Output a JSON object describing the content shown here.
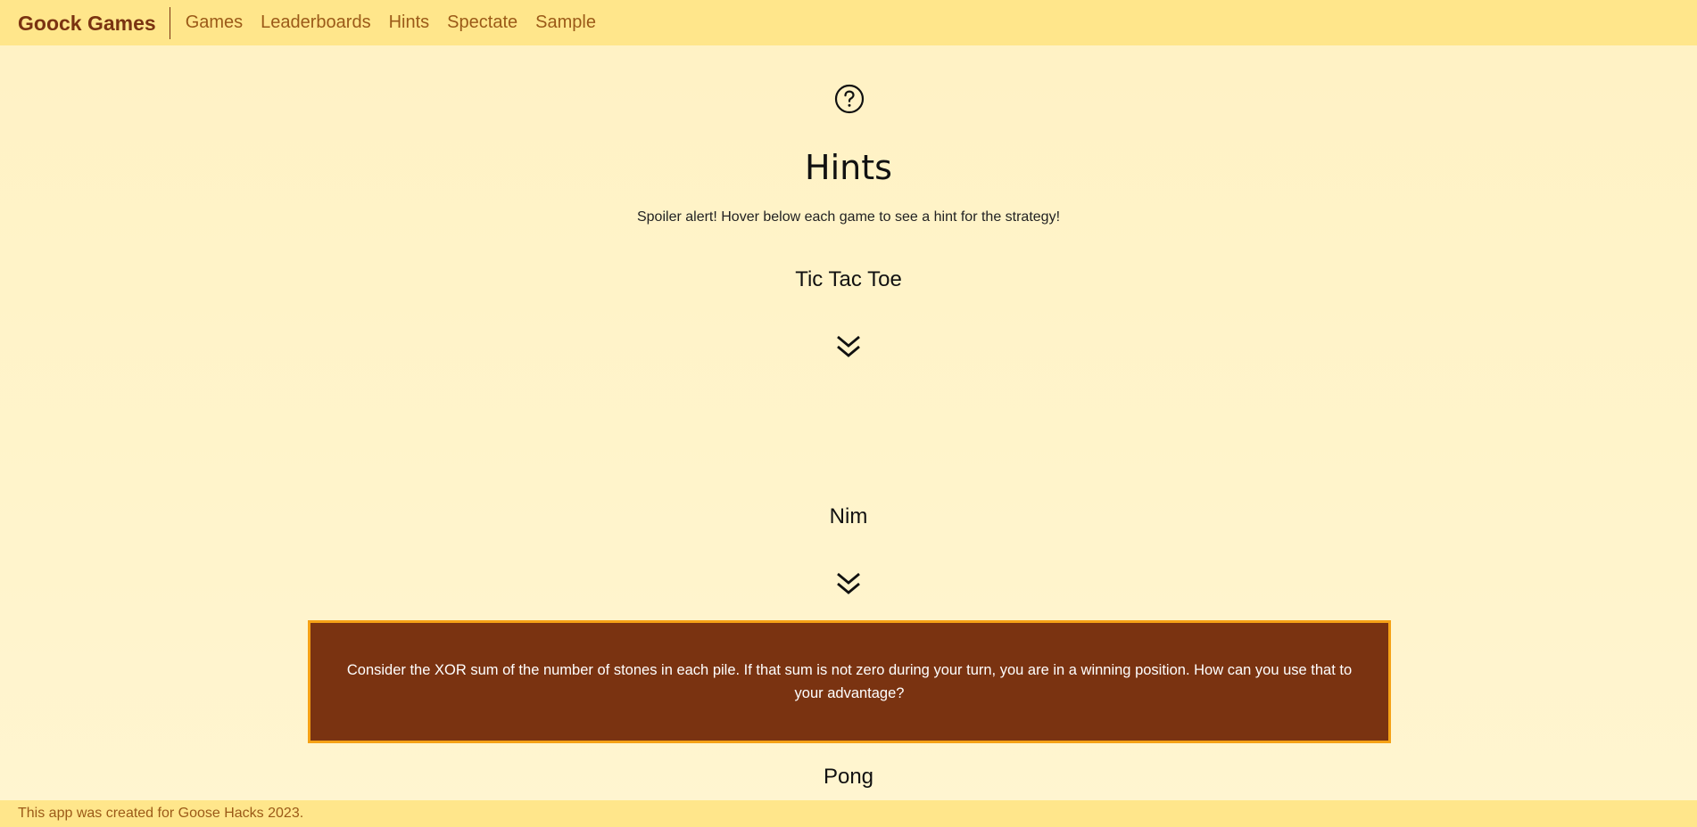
{
  "navbar": {
    "brand": "Goock Games",
    "links": [
      {
        "label": "Games"
      },
      {
        "label": "Leaderboards"
      },
      {
        "label": "Hints"
      },
      {
        "label": "Spectate"
      },
      {
        "label": "Sample"
      }
    ]
  },
  "page": {
    "icon": "question-circle-icon",
    "title": "Hints",
    "subtitle": "Spoiler alert! Hover below each game to see a hint for the strategy!"
  },
  "games": [
    {
      "title": "Tic Tac Toe",
      "hint": ""
    },
    {
      "title": "Nim",
      "hint": "Consider the XOR sum of the number of stones in each pile. If that sum is not zero during your turn, you are in a winning position. How can you use that to your advantage?"
    },
    {
      "title": "Pong",
      "hint": ""
    }
  ],
  "footer": {
    "text": "This app was created for Goose Hacks 2023."
  },
  "colors": {
    "navbar_bg": "#ffe68b",
    "page_bg": "#fff2c4",
    "brand": "#7a3311",
    "hint_bg": "#7a3311",
    "hint_border": "#f5a116"
  }
}
